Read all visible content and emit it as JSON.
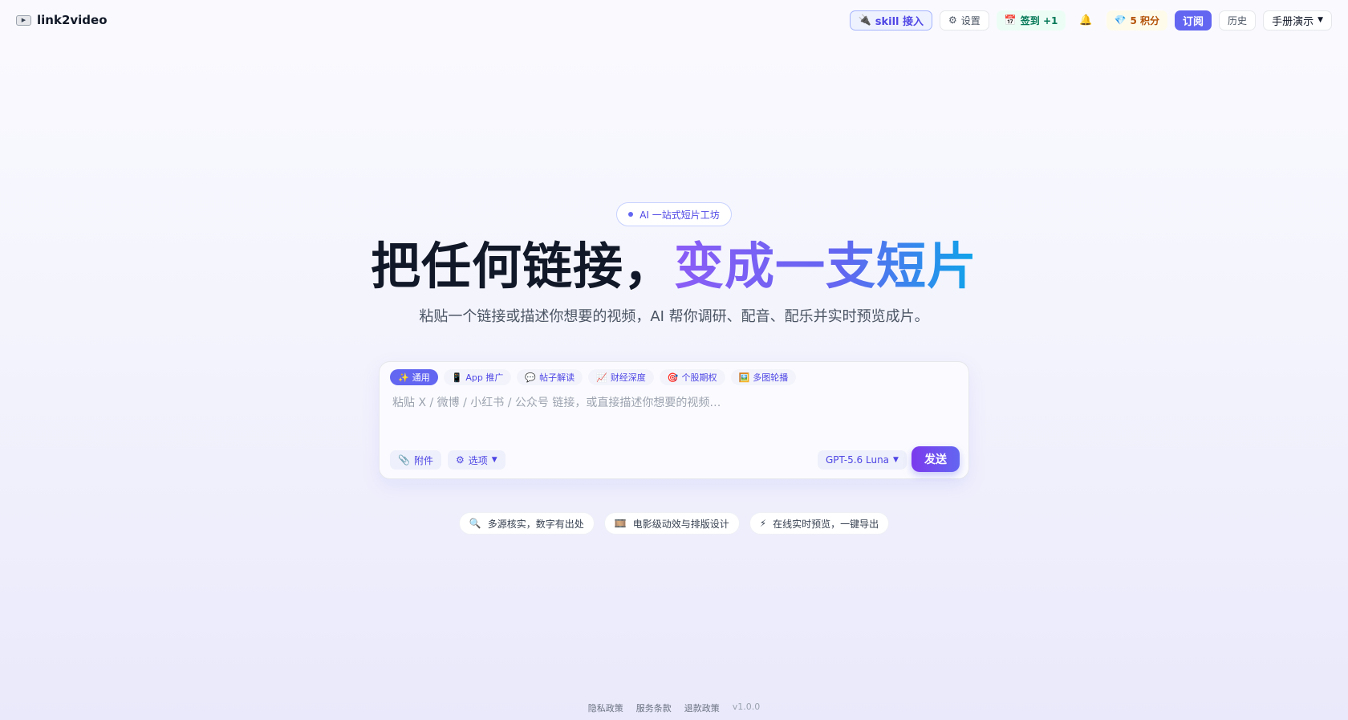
{
  "brand": {
    "logo_icon": "video-tape-icon",
    "name": "link2video"
  },
  "nav": {
    "skill": {
      "icon": "plug-icon",
      "label": "skill 接入"
    },
    "settings": {
      "icon": "gear-icon",
      "label": "设置"
    },
    "checkin": {
      "icon": "calendar-icon",
      "label": "签到 +1"
    },
    "bell_icon": "bell-icon",
    "points": {
      "icon": "gem-icon",
      "label": "5 积分"
    },
    "subscribe": "订阅",
    "history": "历史",
    "manual": "手册演示"
  },
  "hero": {
    "pill": "AI 一站式短片工坊",
    "headline_main": "把任何链接，",
    "headline_accent": "变成一支短片",
    "subline": "粘贴一个链接或描述你想要的视频，AI 帮你调研、配音、配乐并实时预览成片。"
  },
  "composer": {
    "tabs": [
      {
        "icon": "✨",
        "label": "通用",
        "active": true
      },
      {
        "icon": "📱",
        "label": "App 推广"
      },
      {
        "icon": "💬",
        "label": "帖子解读"
      },
      {
        "icon": "📈",
        "label": "财经深度"
      },
      {
        "icon": "🎯",
        "label": "个股期权"
      },
      {
        "icon": "🖼️",
        "label": "多图轮播"
      }
    ],
    "placeholder": "粘贴 X / 微博 / 小红书 / 公众号 链接，或直接描述你想要的视频…",
    "attach_label": "附件",
    "options_label": "选项",
    "model_label": "GPT-5.6 Luna",
    "send_label": "发送"
  },
  "features": [
    {
      "icon": "🔍",
      "label": "多源核实，数字有出处"
    },
    {
      "icon": "🎞️",
      "label": "电影级动效与排版设计"
    },
    {
      "icon": "⚡",
      "label": "在线实时预览，一键导出"
    }
  ],
  "footer": {
    "privacy": "隐私政策",
    "terms": "服务条款",
    "refund": "退款政策",
    "version": "v1.0.0"
  },
  "colors": {
    "accent": "#6366f1",
    "accent_dark": "#4f46e5",
    "gradient_end": "#0ea5e9"
  }
}
